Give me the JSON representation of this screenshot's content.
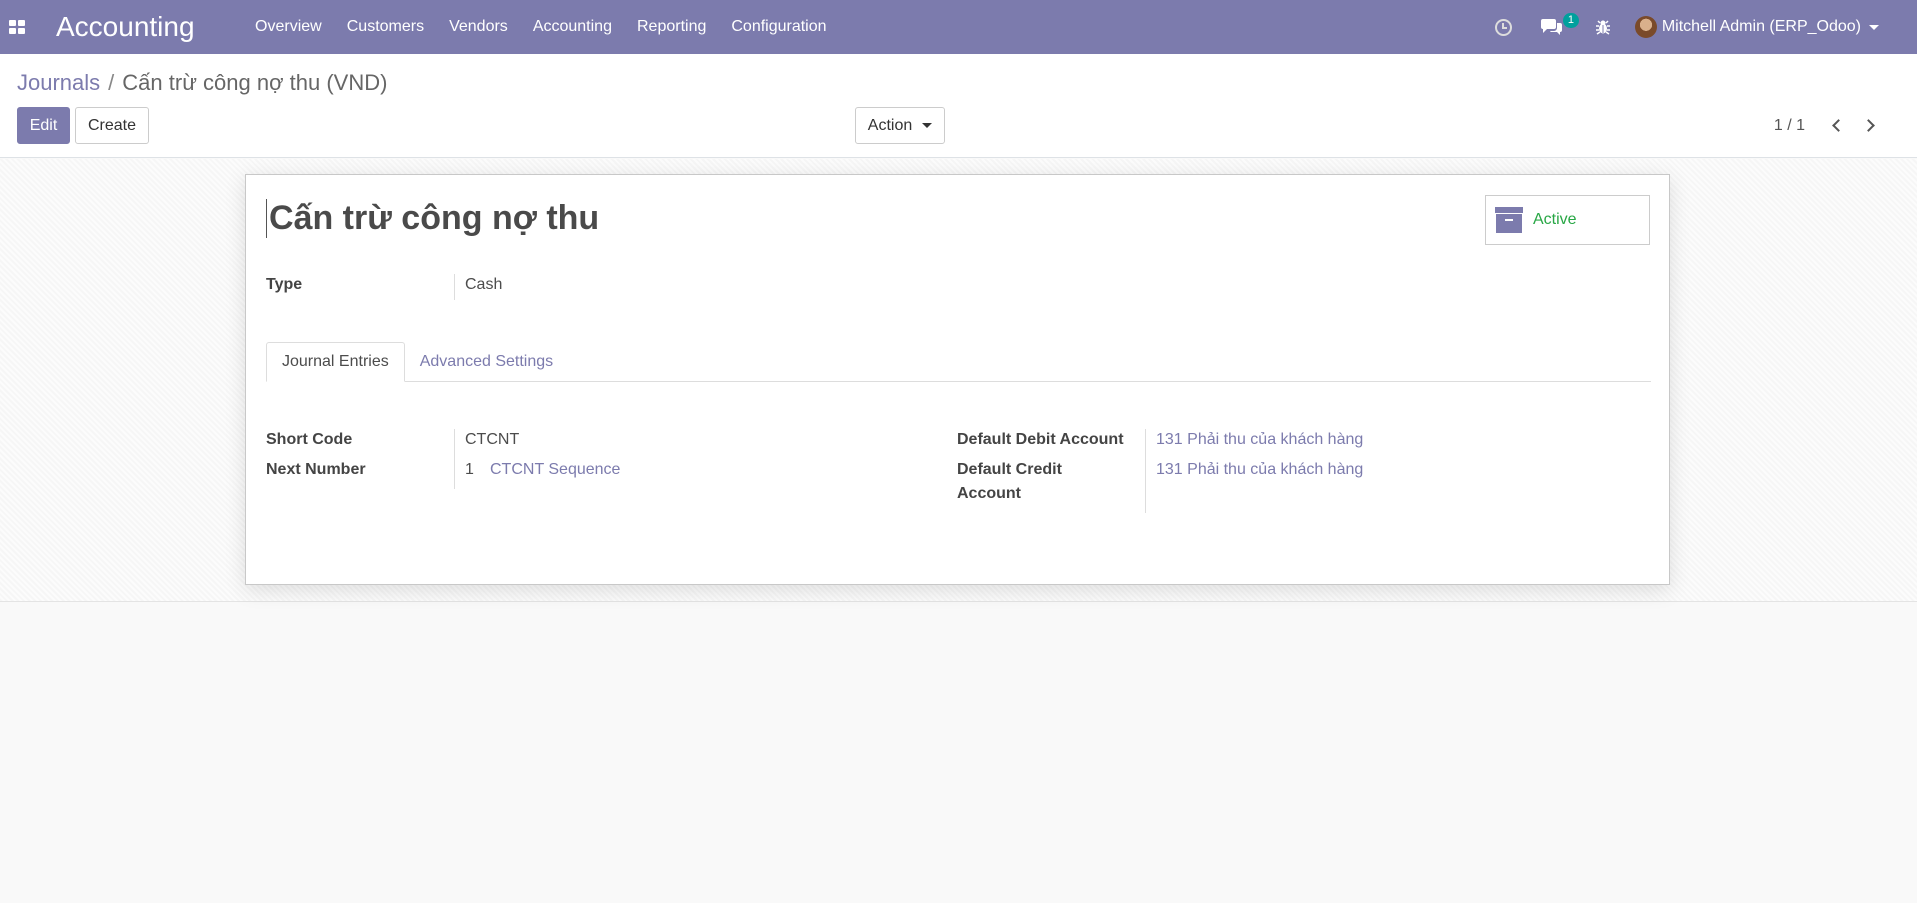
{
  "navbar": {
    "brand": "Accounting",
    "menu": [
      "Overview",
      "Customers",
      "Vendors",
      "Accounting",
      "Reporting",
      "Configuration"
    ],
    "messages_badge": "1",
    "user": "Mitchell Admin (ERP_Odoo)",
    "color": "#7c7bad"
  },
  "breadcrumb": {
    "parent": "Journals",
    "separator": "/",
    "current": "Cấn trừ công nợ thu (VND)"
  },
  "buttons": {
    "edit": "Edit",
    "create": "Create",
    "action": "Action"
  },
  "pager": {
    "value": "1 / 1"
  },
  "record": {
    "name": "Cấn trừ công nợ thu",
    "active_label": "Active",
    "type_label": "Type",
    "type_value": "Cash"
  },
  "tabs": [
    "Journal Entries",
    "Advanced Settings"
  ],
  "journal_entries": {
    "short_code_label": "Short Code",
    "short_code_value": "CTCNT",
    "next_number_label": "Next Number",
    "next_number_value": "1",
    "sequence_link": "CTCNT Sequence",
    "debit_label": "Default Debit Account",
    "debit_value": "131 Phải thu của khách hàng",
    "credit_label_line1": "Default Credit",
    "credit_label_line2": "Account",
    "credit_value": "131 Phải thu của khách hàng"
  },
  "icons": {
    "apps": "apps-grid-icon",
    "activity": "clock-icon",
    "messages": "chat-icon",
    "debug": "bug-icon",
    "archive": "archive-icon",
    "prev": "chevron-left-icon",
    "next": "chevron-right-icon"
  }
}
